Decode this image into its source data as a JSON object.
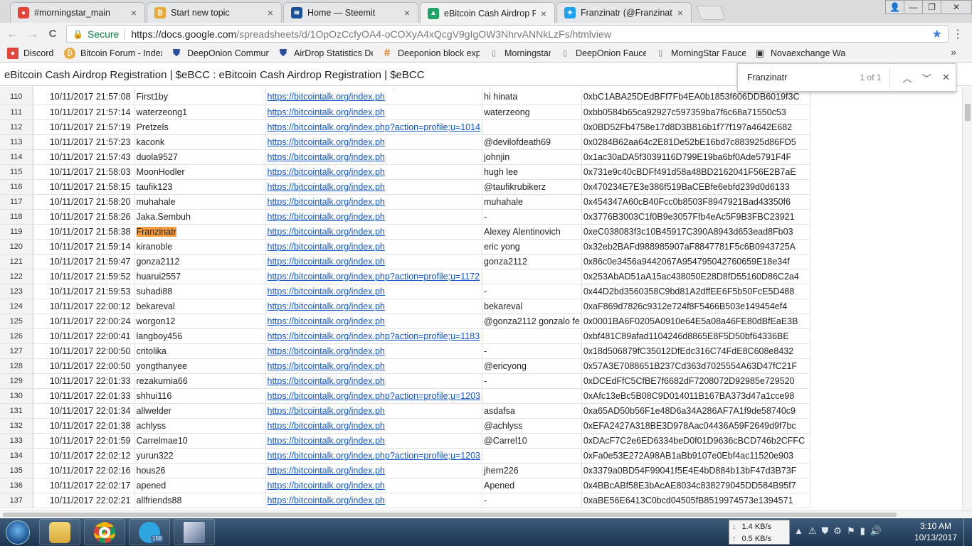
{
  "browser": {
    "tabs": [
      {
        "label": "#morningstar_main",
        "fav_color": "#e0443a",
        "fav_glyph": "●",
        "active": false
      },
      {
        "label": "Start new topic",
        "fav_color": "#e9a93a",
        "fav_glyph": "₿",
        "active": false
      },
      {
        "label": "Home — Steemit",
        "fav_color": "#1a5099",
        "fav_glyph": "≋",
        "active": false
      },
      {
        "label": "eBitcoin Cash Airdrop Re",
        "fav_color": "#1fa463",
        "fav_glyph": "▲",
        "active": true
      },
      {
        "label": "Franzinatr (@Franzinatr) |",
        "fav_color": "#1da1f2",
        "fav_glyph": "✦",
        "active": false
      }
    ],
    "tab_close": "×",
    "window_buttons": {
      "user": "👤",
      "minimize": "—",
      "restore": "❐",
      "close": "✕"
    },
    "nav": {
      "back": "←",
      "forward": "→",
      "reload": "C"
    },
    "address": {
      "secure_label": "Secure",
      "host": "https://docs.google.com",
      "path": "/spreadsheets/d/1OpOzCcfyOA4-oCOXyA4xQcgV9gIgOW3NhrvANNkLzFs/htmlview"
    },
    "bookmark_star": "★",
    "menu": "⋮",
    "bookmarks": [
      {
        "label": "Discord",
        "icon": "discord-icon",
        "color": "#e0443a",
        "glyph": "●"
      },
      {
        "label": "Bitcoin Forum - Index",
        "icon": "bitcoin-icon",
        "color": "#e9a93a",
        "glyph": "₿"
      },
      {
        "label": "DeepOnion Commun",
        "icon": "shield-icon",
        "color": "#2a4fa0",
        "glyph": "⛊"
      },
      {
        "label": "AirDrop Statistics Dee",
        "icon": "shield-icon",
        "color": "#2a4fa0",
        "glyph": "⛊"
      },
      {
        "label": "Deeponion block expl",
        "icon": "hash-icon",
        "color": "#e67e22",
        "glyph": "#"
      },
      {
        "label": "Morningstar",
        "icon": "page-icon",
        "color": "#777777",
        "glyph": "▯"
      },
      {
        "label": "DeepOnion Faucet",
        "icon": "page-icon",
        "color": "#777777",
        "glyph": "▯"
      },
      {
        "label": "MorningStar Faucet",
        "icon": "page-icon",
        "color": "#777777",
        "glyph": "▯"
      },
      {
        "label": "Novaexchange Wallet",
        "icon": "novaexchange-icon",
        "color": "#333333",
        "glyph": "▣"
      }
    ],
    "bookmarks_more": "»"
  },
  "document": {
    "title": "eBitcoin Cash Airdrop Registration | $eBCC : eBitcoin Cash Airdrop Registration | $eBCC"
  },
  "find": {
    "query": "Franzinatr",
    "count": "1 of 1",
    "prev": "︿",
    "next": "﹀",
    "close": "✕"
  },
  "sheet": {
    "rows": [
      {
        "n": "110",
        "ts": "10/11/2017 21:57:08",
        "user": "First1by",
        "link": "https://bitcointalk.org/index.ph",
        "name": "hi hinata",
        "addr": "0xbC1ABA25DEdBFf7Fb4EA0b1853f606DDB6019f3C"
      },
      {
        "n": "111",
        "ts": "10/11/2017 21:57:14",
        "user": "waterzeong1",
        "link": "https://bitcointalk.org/index.ph",
        "name": "waterzeong",
        "addr": "0xbb0584b65ca92927c597359ba7f6c68a71550c53"
      },
      {
        "n": "112",
        "ts": "10/11/2017 21:57:19",
        "user": "Pretzels",
        "link": "https://bitcointalk.org/index.php?action=profile;u=1014",
        "name": "",
        "addr": "0x0BD52Fb4758e17d8D3B816b1f77f197a4642E682"
      },
      {
        "n": "113",
        "ts": "10/11/2017 21:57:23",
        "user": "kaconk",
        "link": "https://bitcointalk.org/index.ph",
        "name": "@devilofdeath69",
        "addr": "0x0284B62aa64c2E81De52bE16bd7c883925d86FD5"
      },
      {
        "n": "114",
        "ts": "10/11/2017 21:57:43",
        "user": "duola9527",
        "link": "https://bitcointalk.org/index.ph",
        "name": "johnjin",
        "addr": "0x1ac30aDA5f3039116D799E19ba6bf0Ade5791F4F"
      },
      {
        "n": "115",
        "ts": "10/11/2017 21:58:03",
        "user": "MoonHodler",
        "link": "https://bitcointalk.org/index.ph",
        "name": "hugh lee",
        "addr": "0x731e9c40cBDFf491d58a48BD2162041F56E2B7aE"
      },
      {
        "n": "116",
        "ts": "10/11/2017 21:58:15",
        "user": "taufik123",
        "link": "https://bitcointalk.org/index.ph",
        "name": "@taufikrubikerz",
        "addr": "0x470234E7E3e386f519BaCEBfe6ebfd239d0d6133"
      },
      {
        "n": "117",
        "ts": "10/11/2017 21:58:20",
        "user": "muhahale",
        "link": "https://bitcointalk.org/index.ph",
        "name": "muhahale",
        "addr": "0x454347A60cB40Fcc0b8503F8947921Bad43350f6"
      },
      {
        "n": "118",
        "ts": "10/11/2017 21:58:26",
        "user": "Jaka.Sembuh",
        "link": "https://bitcointalk.org/index.ph",
        "name": "-",
        "addr": "0x3776B3003C1f0B9e3057Ffb4eAc5F9B3FBC23921"
      },
      {
        "n": "119",
        "ts": "10/11/2017 21:58:38",
        "user": "Franzinatr",
        "link": "https://bitcointalk.org/index.ph",
        "name": "Alexey Alentinovich",
        "addr": "0xeC038083f3c10B45917C390A8943d653ead8Fb03",
        "highlight": true
      },
      {
        "n": "120",
        "ts": "10/11/2017 21:59:14",
        "user": "kiranoble",
        "link": "https://bitcointalk.org/index.ph",
        "name": "eric yong",
        "addr": "0x32eb2BAFd988985907aF8847781F5c6B0943725A"
      },
      {
        "n": "121",
        "ts": "10/11/2017 21:59:47",
        "user": "gonza2112",
        "link": "https://bitcointalk.org/index.ph",
        "name": "gonza2112",
        "addr": "0x86c0e3456a9442067A954795042760659E18e34f"
      },
      {
        "n": "122",
        "ts": "10/11/2017 21:59:52",
        "user": "huarui2557",
        "link": "https://bitcointalk.org/index.php?action=profile;u=1172",
        "name": "",
        "addr": "0x253AbAD51aA15ac438050E28D8fD55160D86C2a4"
      },
      {
        "n": "123",
        "ts": "10/11/2017 21:59:53",
        "user": "suhadi88",
        "link": "https://bitcointalk.org/index.ph",
        "name": "-",
        "addr": "0x44D2bd3560358C9bd81A2dffEE6F5b50FcE5D488"
      },
      {
        "n": "124",
        "ts": "10/11/2017 22:00:12",
        "user": "bekareval",
        "link": "https://bitcointalk.org/index.ph",
        "name": "bekareval",
        "addr": "0xaF869d7826c9312e724f8F5466B503e149454ef4"
      },
      {
        "n": "125",
        "ts": "10/11/2017 22:00:24",
        "user": "worgon12",
        "link": "https://bitcointalk.org/index.ph",
        "name": "@gonza2112 gonzalo fe",
        "addr": "0x0001BA6F0205A0910e64E5a08a46FE80dBfEaE3B"
      },
      {
        "n": "126",
        "ts": "10/11/2017 22:00:41",
        "user": "langboy456",
        "link": "https://bitcointalk.org/index.php?action=profile;u=1183",
        "name": "",
        "addr": "0xbf481C89afad1104246d8865E8F5D50bf64336BE"
      },
      {
        "n": "127",
        "ts": "10/11/2017 22:00:50",
        "user": "critolika",
        "link": "https://bitcointalk.org/index.ph",
        "name": "-",
        "addr": "0x18d506879fC35012DfEdc316C74FdE8C608e8432"
      },
      {
        "n": "128",
        "ts": "10/11/2017 22:00:50",
        "user": "yongthanyee",
        "link": "https://bitcointalk.org/index.ph",
        "name": "@ericyong",
        "addr": "0x57A3E7088651B237Cd363d7025554A63D47fC21F"
      },
      {
        "n": "129",
        "ts": "10/11/2017 22:01:33",
        "user": "rezakurnia66",
        "link": "https://bitcointalk.org/index.ph",
        "name": "-",
        "addr": "0xDCEdFfC5CfBE7f6682dF7208072D92985e729520"
      },
      {
        "n": "130",
        "ts": "10/11/2017 22:01:33",
        "user": "shhui116",
        "link": "https://bitcointalk.org/index.php?action=profile;u=1203",
        "name": "",
        "addr": "0xAfc13eBc5B08C9D014011B167BA373d47a1cce98"
      },
      {
        "n": "131",
        "ts": "10/11/2017 22:01:34",
        "user": "allwelder",
        "link": "https://bitcointalk.org/index.ph",
        "name": "asdafsa",
        "addr": "0xa65AD50b56F1e48D6a34A286AF7A1f9de58740c9"
      },
      {
        "n": "132",
        "ts": "10/11/2017 22:01:38",
        "user": "achlyss",
        "link": "https://bitcointalk.org/index.ph",
        "name": "@achlyss",
        "addr": "0xEFA2427A318BE3D978Aac04436A59F2649d9f7bc"
      },
      {
        "n": "133",
        "ts": "10/11/2017 22:01:59",
        "user": "Carrelmae10",
        "link": "https://bitcointalk.org/index.ph",
        "name": "@Carrel10",
        "addr": "0xDAcF7C2e6ED6334beD0f01D9636cBCD746b2CFFC"
      },
      {
        "n": "134",
        "ts": "10/11/2017 22:02:12",
        "user": "yurun322",
        "link": "https://bitcointalk.org/index.php?action=profile;u=1203",
        "name": "",
        "addr": "0xFa0e53E272A98AB1aBb9107e0Ebf4ac11520e903"
      },
      {
        "n": "135",
        "ts": "10/11/2017 22:02:16",
        "user": "hous26",
        "link": "https://bitcointalk.org/index.ph",
        "name": "jhern226",
        "addr": "0x3379a0BD54F99041f5E4E4bD884b13bF47d3B73F"
      },
      {
        "n": "136",
        "ts": "10/11/2017 22:02:17",
        "user": "apened",
        "link": "https://bitcointalk.org/index.ph",
        "name": "Apened",
        "addr": "0x4BBcABf58E3bAcAE8034c838279045DD584B95f7"
      },
      {
        "n": "137",
        "ts": "10/11/2017 22:02:21",
        "user": "allfriends88",
        "link": "https://bitcointalk.org/index.ph",
        "name": "-",
        "addr": "0xaBE56E6413C0bcd04505fB8519974573e1394571"
      }
    ],
    "highlight_color": "#f89b3c",
    "link_color": "#1155cc"
  },
  "taskbar": {
    "apps": [
      {
        "name": "explorer",
        "color": "#e8c14a"
      },
      {
        "name": "chrome",
        "color": "#4285f4"
      },
      {
        "name": "telegram",
        "color": "#2ca5e0",
        "badge": "158"
      },
      {
        "name": "paint",
        "color": "#5b6f96"
      }
    ],
    "net": {
      "down": "1.4 KB/s",
      "up": "0.5 KB/s"
    },
    "tray_icons": [
      "▲",
      "⚠",
      "⛊",
      "⚙",
      "⚑",
      "▮",
      "🔊"
    ],
    "time": "3:10 AM",
    "date": "10/13/2017"
  }
}
